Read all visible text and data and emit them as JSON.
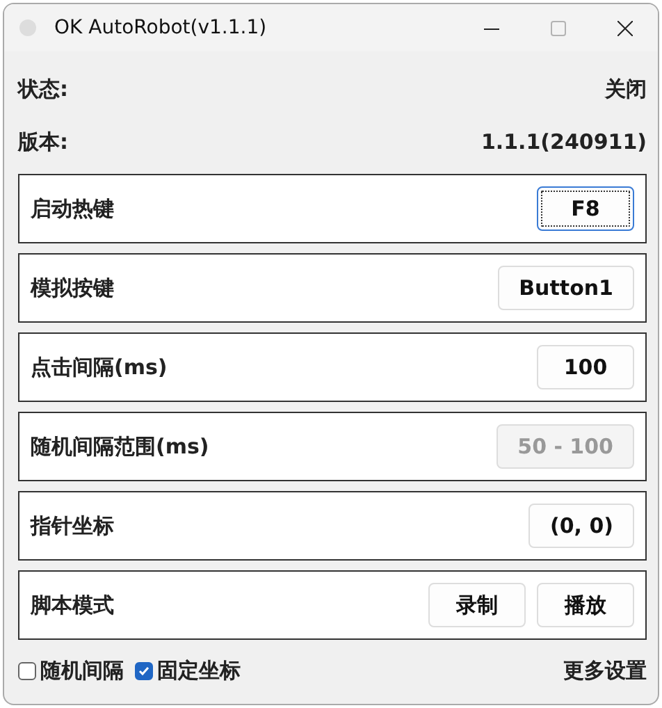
{
  "window": {
    "title": "OK AutoRobot(v1.1.1)",
    "maximize_disabled": true
  },
  "info": [
    {
      "label": "状态:",
      "value": "关闭"
    },
    {
      "label": "版本:",
      "value": "1.1.1(240911)"
    }
  ],
  "settings": [
    {
      "kind": "value",
      "label": "启动热键",
      "value": "F8",
      "disabled": false,
      "focused": true
    },
    {
      "kind": "value",
      "label": "模拟按键",
      "value": "Button1",
      "disabled": false,
      "focused": false
    },
    {
      "kind": "value",
      "label": "点击间隔(ms)",
      "value": "100",
      "disabled": false,
      "focused": false
    },
    {
      "kind": "value",
      "label": "随机间隔范围(ms)",
      "value": "50 - 100",
      "disabled": true,
      "focused": false
    },
    {
      "kind": "value",
      "label": "指针坐标",
      "value": "(0, 0)",
      "disabled": false,
      "focused": false
    },
    {
      "kind": "buttons",
      "label": "脚本模式",
      "buttons": [
        "录制",
        "播放"
      ]
    }
  ],
  "options": [
    {
      "label": "随机间隔",
      "checked": false
    },
    {
      "label": "固定坐标",
      "checked": true
    }
  ],
  "more_link": "更多设置"
}
